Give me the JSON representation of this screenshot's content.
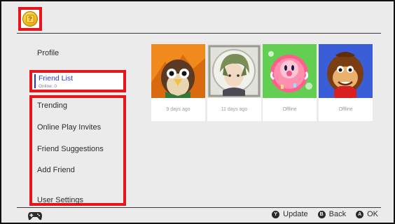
{
  "header": {
    "avatar_icon": "question-block-coin-icon"
  },
  "sidebar": {
    "profile_label": "Profile",
    "friend_list": {
      "label": "Friend List",
      "status": "Online: 0"
    },
    "items": [
      {
        "label": "Trending"
      },
      {
        "label": "Online Play Invites"
      },
      {
        "label": "Friend Suggestions"
      },
      {
        "label": "Add Friend"
      },
      {
        "label": "User Settings"
      }
    ]
  },
  "friends": [
    {
      "status": "9 days ago",
      "avatar_icon": "owl-character-icon",
      "bg_color": "#f08a1c"
    },
    {
      "status": "11 days ago",
      "avatar_icon": "green-haired-character-icon",
      "bg_color": "#e2e2dc"
    },
    {
      "status": "Offline",
      "avatar_icon": "pink-round-character-icon",
      "bg_color": "#62cf52"
    },
    {
      "status": "Offline",
      "avatar_icon": "ape-character-icon",
      "bg_color": "#3a5ed8"
    }
  ],
  "footer": {
    "controller_icon": "controller-icon",
    "actions": [
      {
        "key": "Y",
        "label": "Update"
      },
      {
        "key": "B",
        "label": "Back"
      },
      {
        "key": "A",
        "label": "OK"
      }
    ]
  },
  "colors": {
    "highlight_border": "#e8141c",
    "selected_text": "#2a3acd",
    "background": "#ebebeb"
  }
}
